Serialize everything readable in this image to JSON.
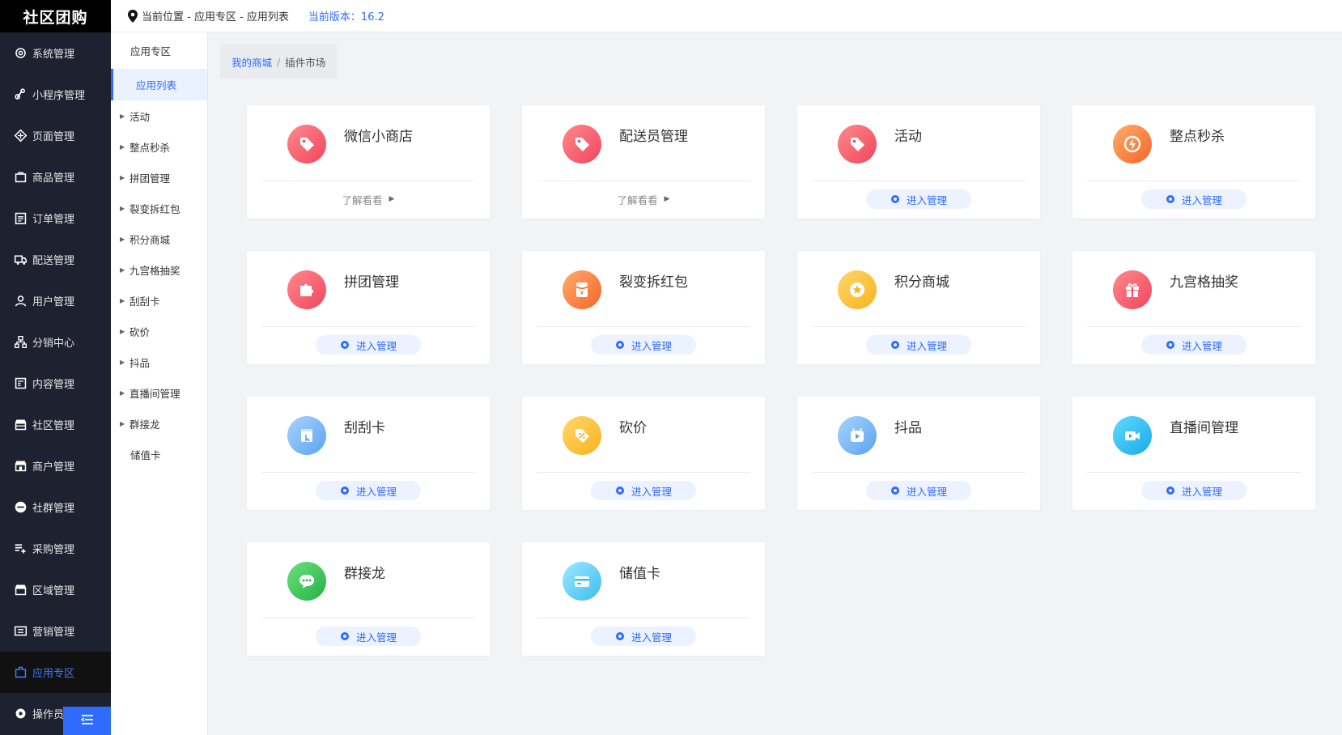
{
  "app": {
    "logo": "社区团购"
  },
  "header": {
    "location": "当前位置 - 应用专区 - 应用列表",
    "version": "当前版本：16.2"
  },
  "sidebar": {
    "items": [
      {
        "label": "系统管理",
        "icon": "gear-icon"
      },
      {
        "label": "小程序管理",
        "icon": "link-icon"
      },
      {
        "label": "页面管理",
        "icon": "diamond-icon"
      },
      {
        "label": "商品管理",
        "icon": "bag-icon"
      },
      {
        "label": "订单管理",
        "icon": "list-icon"
      },
      {
        "label": "配送管理",
        "icon": "truck-icon"
      },
      {
        "label": "用户管理",
        "icon": "user-icon"
      },
      {
        "label": "分销中心",
        "icon": "tree-icon"
      },
      {
        "label": "内容管理",
        "icon": "doc-icon"
      },
      {
        "label": "社区管理",
        "icon": "store-icon"
      },
      {
        "label": "商户管理",
        "icon": "shop-icon"
      },
      {
        "label": "社群管理",
        "icon": "minus-circle-icon"
      },
      {
        "label": "采购管理",
        "icon": "add-list-icon"
      },
      {
        "label": "区域管理",
        "icon": "area-icon"
      },
      {
        "label": "营销管理",
        "icon": "ticket-icon"
      },
      {
        "label": "应用专区",
        "icon": "app-icon",
        "active": true
      },
      {
        "label": "操作员",
        "icon": "cog-icon"
      }
    ]
  },
  "subnav": {
    "header": "应用专区",
    "current": "应用列表",
    "items": [
      "活动",
      "整点秒杀",
      "拼团管理",
      "裂变拆红包",
      "积分商城",
      "九宫格抽奖",
      "刮刮卡",
      "砍价",
      "抖品",
      "直播间管理",
      "群接龙"
    ],
    "last": "储值卡"
  },
  "breadcrumb": {
    "home": "我的商城",
    "sep": "/",
    "current": "插件市场"
  },
  "cards": [
    {
      "title": "微信小商店",
      "action": "了解看看",
      "type": "more",
      "icon": "tag-icon",
      "color": "#f0455f"
    },
    {
      "title": "配送员管理",
      "action": "了解看看",
      "type": "more",
      "icon": "tag-icon",
      "color": "#f0455f"
    },
    {
      "title": "活动",
      "action": "进入管理",
      "type": "manage",
      "icon": "tag-icon",
      "color": "#f0455f"
    },
    {
      "title": "整点秒杀",
      "action": "进入管理",
      "type": "manage",
      "icon": "flash-icon",
      "color": "#f76428"
    },
    {
      "title": "拼团管理",
      "action": "进入管理",
      "type": "manage",
      "icon": "puzzle-icon",
      "color": "#f0455f"
    },
    {
      "title": "裂变拆红包",
      "action": "进入管理",
      "type": "manage",
      "icon": "red-envelope-icon",
      "color": "#f76428"
    },
    {
      "title": "积分商城",
      "action": "进入管理",
      "type": "manage",
      "icon": "star-icon",
      "color": "#f9b21d"
    },
    {
      "title": "九宫格抽奖",
      "action": "进入管理",
      "type": "manage",
      "icon": "gift-icon",
      "color": "#f0455f"
    },
    {
      "title": "刮刮卡",
      "action": "进入管理",
      "type": "manage",
      "icon": "scratch-card-icon",
      "color": "#5aa3f0"
    },
    {
      "title": "砍价",
      "action": "进入管理",
      "type": "manage",
      "icon": "discount-tag-icon",
      "color": "#f9b21d"
    },
    {
      "title": "抖品",
      "action": "进入管理",
      "type": "manage",
      "icon": "play-icon",
      "color": "#5aa3f0"
    },
    {
      "title": "直播间管理",
      "action": "进入管理",
      "type": "manage",
      "icon": "video-camera-icon",
      "color": "#1aa9e8"
    },
    {
      "title": "群接龙",
      "action": "进入管理",
      "type": "manage",
      "icon": "chat-icon",
      "color": "#23b146"
    },
    {
      "title": "储值卡",
      "action": "进入管理",
      "type": "manage",
      "icon": "card-icon",
      "color": "#3bbdee"
    }
  ]
}
